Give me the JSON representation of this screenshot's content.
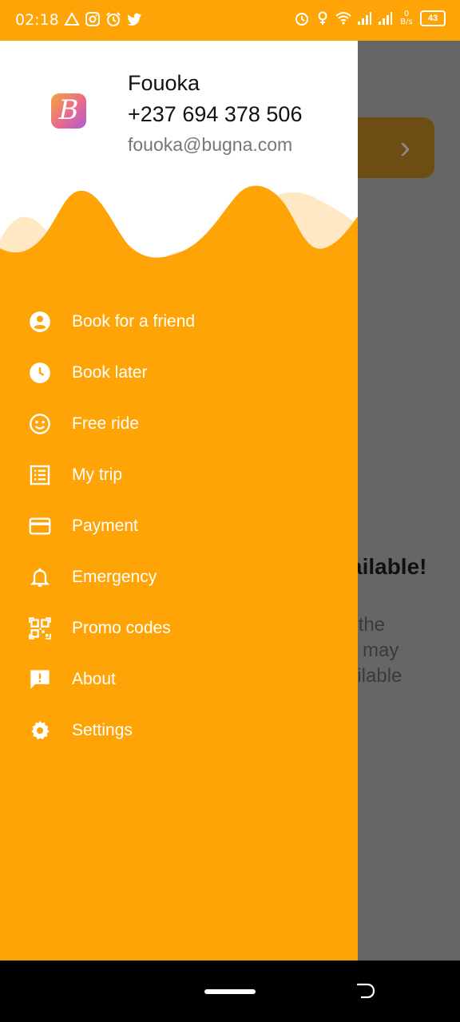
{
  "status_bar": {
    "time": "02:18",
    "net_speed_top": "0",
    "net_speed_bottom": "B/s",
    "battery": "43",
    "left_icons": [
      "alert-triangle-icon",
      "instagram-icon",
      "alarm-icon",
      "twitter-icon"
    ],
    "right_icons": [
      "alarm-icon",
      "location-icon",
      "wifi-icon",
      "signal-icon",
      "signal-icon"
    ]
  },
  "background": {
    "title_fragment": "ailable!",
    "text_fragment": "r the\nu may\nailable"
  },
  "drawer": {
    "logo_letter": "B",
    "user": {
      "name": "Fouoka",
      "phone": "+237 694 378 506",
      "email": "fouoka@bugna.com"
    },
    "menu": [
      {
        "label": "Book for a friend",
        "icon": "account-circle-icon"
      },
      {
        "label": "Book later",
        "icon": "clock-icon"
      },
      {
        "label": "Free ride",
        "icon": "smiley-icon"
      },
      {
        "label": "My trip",
        "icon": "list-icon"
      },
      {
        "label": "Payment",
        "icon": "credit-card-icon"
      },
      {
        "label": "Emergency",
        "icon": "bell-icon"
      },
      {
        "label": "Promo codes",
        "icon": "qr-code-icon"
      },
      {
        "label": "About",
        "icon": "feedback-icon"
      },
      {
        "label": "Settings",
        "icon": "gear-icon"
      }
    ]
  },
  "colors": {
    "accent": "#FFA407",
    "scrim": "#666666",
    "header_bg": "#FFFFFF",
    "wave_light": "#FFE9C4"
  }
}
